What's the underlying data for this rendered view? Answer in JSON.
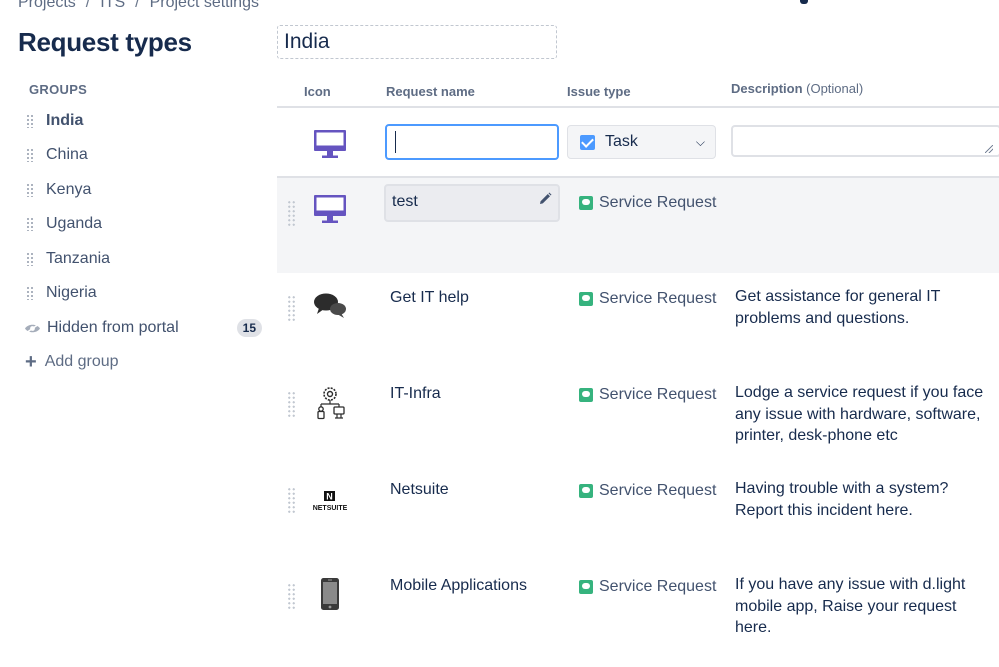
{
  "breadcrumbs": [
    "Projects",
    "ITS",
    "Project settings"
  ],
  "page_title": "Request types",
  "sidebar": {
    "groups_label": "GROUPS",
    "groups": [
      {
        "label": "India",
        "active": true
      },
      {
        "label": "China"
      },
      {
        "label": "Kenya"
      },
      {
        "label": "Uganda"
      },
      {
        "label": "Tanzania"
      },
      {
        "label": "Nigeria"
      }
    ],
    "hidden": {
      "label": "Hidden from portal",
      "count": "15"
    },
    "add_group": "Add group"
  },
  "group_name": "India",
  "columns": {
    "icon": "Icon",
    "request_name": "Request name",
    "issue_type": "Issue type",
    "description": "Description",
    "description_optional": "(Optional)"
  },
  "new_request": {
    "name_value": "",
    "issue_type": "Task",
    "description_value": ""
  },
  "requests": [
    {
      "icon": "monitor-icon",
      "name": "test",
      "issue_type": "Service Request",
      "description": "",
      "editing": true
    },
    {
      "icon": "chat-bubbles-icon",
      "name": "Get IT help",
      "issue_type": "Service Request",
      "description": "Get assistance for general IT problems and questions."
    },
    {
      "icon": "it-infra-icon",
      "name": "IT-Infra",
      "issue_type": "Service Request",
      "description": "Lodge a service request if you face any issue with hardware, software, printer, desk-phone etc"
    },
    {
      "icon": "netsuite-logo-icon",
      "name": "Netsuite",
      "issue_type": "Service Request",
      "description": "Having trouble with a system? Report this incident here.",
      "logo_text": "NETSUITE",
      "logo_letter": "N"
    },
    {
      "icon": "mobile-phone-icon",
      "name": "Mobile Applications",
      "issue_type": "Service Request",
      "description": "If you have any issue with d.light mobile app, Raise your request here."
    }
  ],
  "colors": {
    "accent": "#4c9aff",
    "service_request": "#36b37e",
    "monitor": "#6554c0",
    "heading": "#172b4d"
  }
}
